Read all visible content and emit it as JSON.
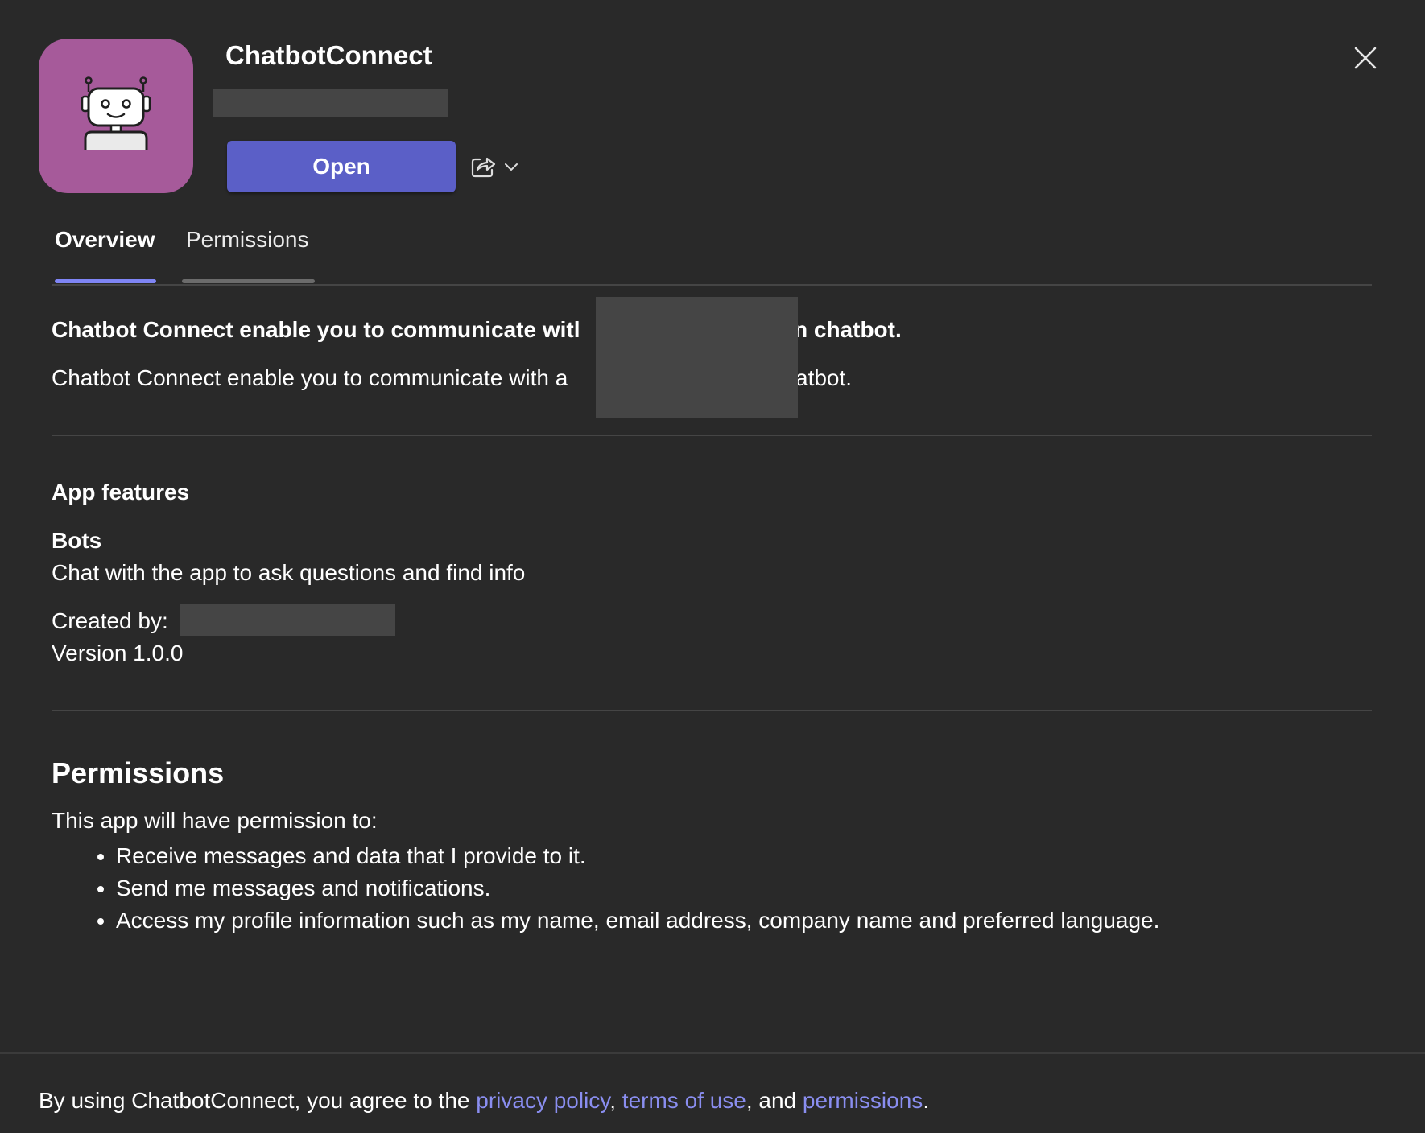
{
  "app": {
    "title": "ChatbotConnect",
    "icon": "robot-icon",
    "open_label": "Open",
    "close_icon": "close-icon",
    "share_icon": "share-icon",
    "chevron_icon": "chevron-down-icon",
    "accent_color": "#5b5fc7",
    "icon_bg_color": "#a65a9a"
  },
  "tabs": [
    {
      "label": "Overview",
      "active": true
    },
    {
      "label": "Permissions",
      "active": false
    }
  ],
  "overview": {
    "headline": "Chatbot Connect enable you to communicate witl",
    "headline_tail": "n chatbot.",
    "description": "Chatbot Connect enable you to communicate with a",
    "description_tail": "atbot.",
    "features_heading": "App features",
    "feature_name": "Bots",
    "feature_desc": "Chat with the app to ask questions and find info",
    "created_by_label": "Created by:",
    "version": "Version 1.0.0"
  },
  "permissions": {
    "heading": "Permissions",
    "intro": "This app will have permission to:",
    "items": [
      "Receive messages and data that I provide to it.",
      "Send me messages and notifications.",
      "Access my profile information such as my name, email address, company name and preferred language."
    ]
  },
  "footer": {
    "prefix": "By using ChatbotConnect, you agree to the",
    "privacy_link": "privacy policy",
    "sep1": ",",
    "terms_link": "terms of use",
    "sep2": ", and",
    "permissions_link": "permissions",
    "suffix": "."
  }
}
